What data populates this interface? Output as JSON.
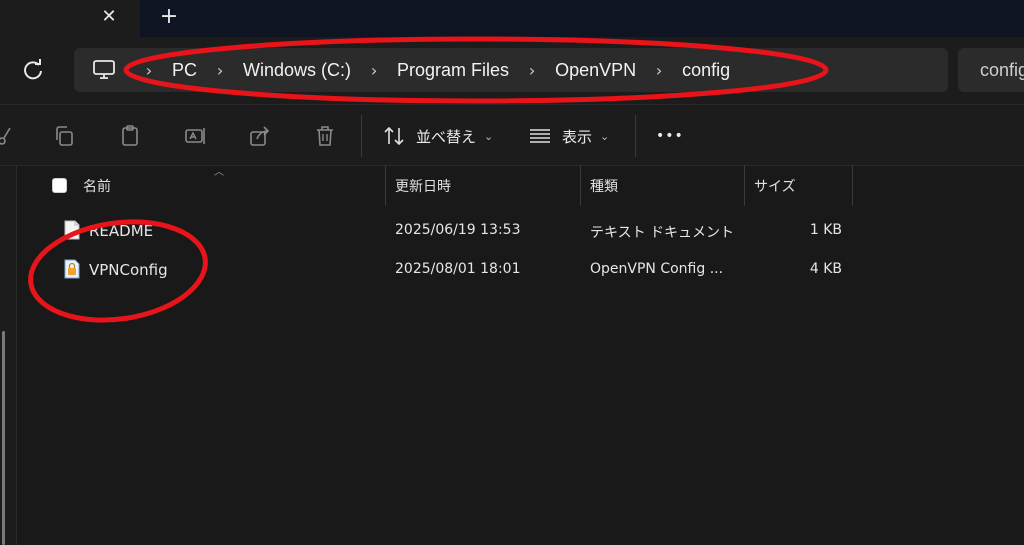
{
  "tabbar": {
    "close_glyph": "✕",
    "new_tab_glyph": "+"
  },
  "address": {
    "root_icon": "computer-icon",
    "separator": "›",
    "crumbs": [
      "PC",
      "Windows (C:)",
      "Program Files",
      "OpenVPN",
      "config"
    ]
  },
  "search": {
    "text": "config"
  },
  "toolbar": {
    "icons": [
      "cut-icon",
      "copy-icon",
      "paste-icon",
      "rename-icon",
      "share-icon",
      "delete-icon"
    ],
    "sort_label": "並べ替え",
    "view_label": "表示",
    "more_glyph": "•••",
    "chevron": "⌄"
  },
  "columns": {
    "name": "名前",
    "date": "更新日時",
    "type": "種類",
    "size": "サイズ"
  },
  "files": [
    {
      "name": "README",
      "date": "2025/06/19 13:53",
      "type": "テキスト ドキュメント",
      "size": "1 KB",
      "icon": "text-document-icon"
    },
    {
      "name": "VPNConfig",
      "date": "2025/08/01 18:01",
      "type": "OpenVPN Config ...",
      "size": "4 KB",
      "icon": "openvpn-config-icon"
    }
  ],
  "colors": {
    "annotation": "#e8141a",
    "window_bg": "#191919",
    "tabbar_bg": "#0f1422"
  }
}
